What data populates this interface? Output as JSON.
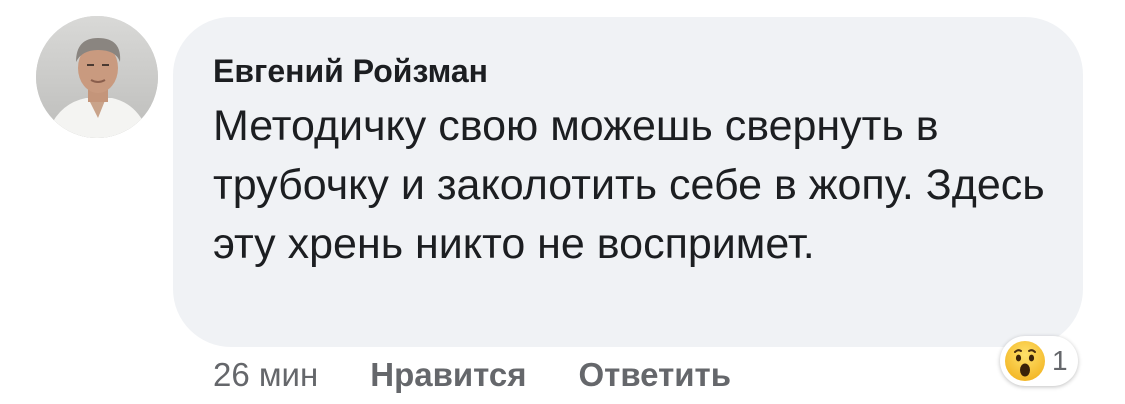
{
  "comment": {
    "author": "Евгений Ройзман",
    "text": "Методичку свою можешь свернуть в трубочку и заколотить себе в жопу. Здесь эту хрень никто не воспримет.",
    "reaction": {
      "icon": "wow-emoji-icon",
      "count": "1"
    },
    "actions": {
      "time": "26 мин",
      "like_label": "Нравится",
      "reply_label": "Ответить"
    }
  },
  "colors": {
    "bubble_bg": "#f0f2f5",
    "text": "#1c1e21",
    "secondary_text": "#65676b",
    "wow_yellow": "#f7c335"
  }
}
